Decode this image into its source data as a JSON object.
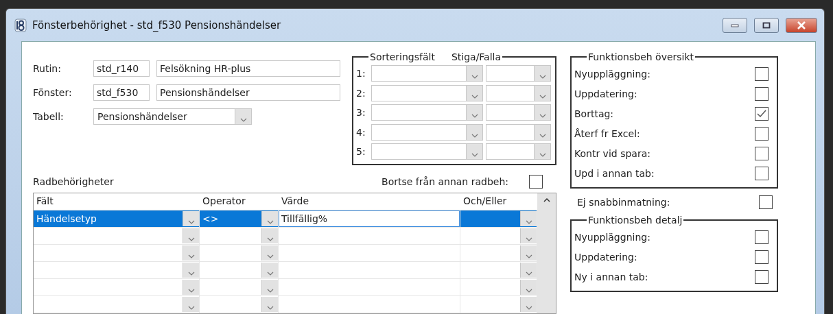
{
  "window": {
    "title": "Fönsterbehörighet - std_f530 Pensionshändelser"
  },
  "identity": [
    {
      "label": "Rutin:",
      "code": "std_r140",
      "name": "Felsökning HR-plus"
    },
    {
      "label": "Fönster:",
      "code": "std_f530",
      "name": "Pensionshändelser"
    }
  ],
  "table_field": {
    "label": "Tabell:",
    "value": "Pensionshändelser"
  },
  "sorting": {
    "field_legend": "Sorteringsfält",
    "order_legend": "Stiga/Falla",
    "rows": [
      {
        "label": "1:"
      },
      {
        "label": "2:"
      },
      {
        "label": "3:"
      },
      {
        "label": "4:"
      },
      {
        "label": "5:"
      }
    ]
  },
  "row_permissions": {
    "label": "Radbehörigheter",
    "ignore_other": {
      "label": "Bortse från annan radbeh:",
      "checked": false
    },
    "columns": [
      "Fält",
      "Operator",
      "Värde",
      "Och/Eller"
    ],
    "rows": [
      {
        "selected": true,
        "field": "Händelsetyp",
        "operator": "<>",
        "value": "Tillfällig%"
      },
      {
        "selected": false
      },
      {
        "selected": false
      },
      {
        "selected": false
      },
      {
        "selected": false
      },
      {
        "selected": false
      }
    ]
  },
  "function_overview": {
    "legend": "Funktionsbeh översikt",
    "items": [
      {
        "label": "Nyuppläggning:",
        "checked": false
      },
      {
        "label": "Uppdatering:",
        "checked": false
      },
      {
        "label": "Borttag:",
        "checked": true
      },
      {
        "label": "Återf fr Excel:",
        "checked": false
      },
      {
        "label": "Kontr vid spara:",
        "checked": false
      },
      {
        "label": "Upd i annan tab:",
        "checked": false
      }
    ]
  },
  "no_quick_entry": {
    "label": "Ej snabbinmatning:",
    "checked": false
  },
  "function_detail": {
    "legend": "Funktionsbeh detalj",
    "items": [
      {
        "label": "Nyuppläggning:",
        "checked": false
      },
      {
        "label": "Uppdatering:",
        "checked": false
      },
      {
        "label": "Ny i annan tab:",
        "checked": false
      }
    ]
  }
}
